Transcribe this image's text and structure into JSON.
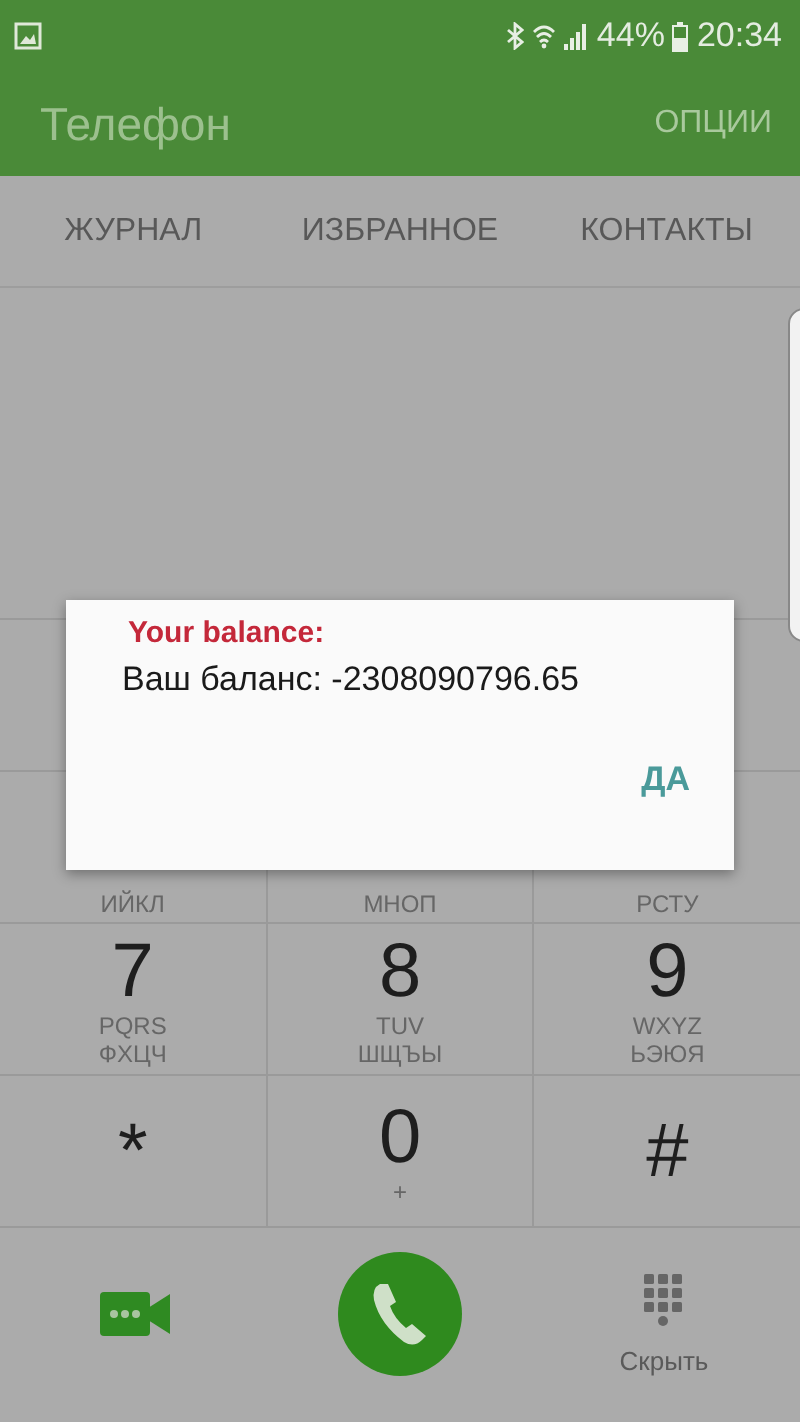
{
  "status_bar": {
    "battery": "44%",
    "time": "20:34"
  },
  "app_bar": {
    "title": "Телефон",
    "menu": "ОПЦИИ"
  },
  "tabs": [
    {
      "label": "ЖУРНАЛ",
      "selected": false
    },
    {
      "label": "ИЗБРАННОЕ",
      "selected": false
    },
    {
      "label": "КОНТАКТЫ",
      "selected": false
    }
  ],
  "keypad": [
    {
      "keys": [
        {
          "cyrillic": "ИЙКЛ"
        },
        {
          "cyrillic": "МНОП"
        },
        {
          "cyrillic": "РСТУ"
        }
      ]
    },
    {
      "keys": [
        {
          "digit": "7",
          "latin": "PQRS",
          "cyrillic": "ФХЦЧ"
        },
        {
          "digit": "8",
          "latin": "TUV",
          "cyrillic": "ШЩЪЫ"
        },
        {
          "digit": "9",
          "latin": "WXYZ",
          "cyrillic": "ЬЭЮЯ"
        }
      ]
    },
    {
      "keys": [
        {
          "digit": "*"
        },
        {
          "digit": "0",
          "latin": "+"
        },
        {
          "digit": "#"
        }
      ]
    }
  ],
  "bottom_bar": {
    "hide_label": "Скрыть"
  },
  "dialog": {
    "title": "Your balance:",
    "message": "Ваш баланс: -2308090796.65",
    "button": "ДА"
  }
}
